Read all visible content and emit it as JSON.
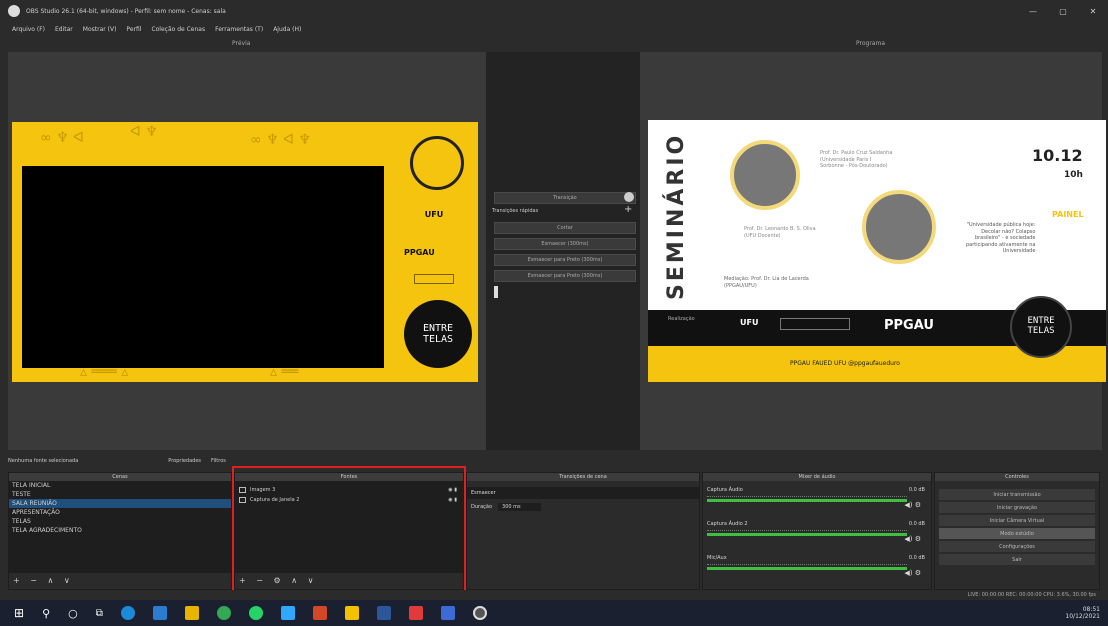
{
  "titlebar": {
    "title": "OBS Studio 26.1 (64-bit, windows) - Perfil: sem nome - Cenas: sala",
    "min": "—",
    "max": "▢",
    "close": "✕"
  },
  "menu": [
    "Arquivo (F)",
    "Editar",
    "Mostrar (V)",
    "Perfil",
    "Coleção de Cenas",
    "Ferramentas (T)",
    "Ajuda (H)"
  ],
  "labels": {
    "preview": "Prévia",
    "program": "Programa"
  },
  "transition_panel": {
    "transicao": "Transição",
    "transicoes_rapidas": "Transições rápidas",
    "cortar": "Cortar",
    "esmaecer": "Esmaecer (300ms)",
    "esmaecer_preto1": "Esmaecer para Preto (300ms)",
    "esmaecer_preto2": "Esmaecer para Preto (300ms)"
  },
  "source_status": {
    "text": "Nenhuma fonte selecionada",
    "props": "Propriedades",
    "filters": "Filtros"
  },
  "scenes": {
    "header": "Cenas",
    "items": [
      "TELA INICIAL",
      "TESTE",
      "SALA REUNIÃO",
      "APRESENTAÇÃO",
      "TELAS",
      "TELA AGRADECIMENTO"
    ],
    "selected_index": 2,
    "tools": "+ − ∧ ∨"
  },
  "sources": {
    "header": "Fontes",
    "items": [
      "Imagem 3",
      "Captura de Janela 2"
    ],
    "tools": "+ − ⚙ ∧ ∨"
  },
  "transitions_dock": {
    "header": "Transições de cena",
    "row1": "Esmaecer",
    "row2_label": "Duração",
    "row2_value": "300 ms"
  },
  "mixer": {
    "header": "Mixer de áudio",
    "channels": [
      {
        "name": "Captura Áudio",
        "db": "0.0 dB"
      },
      {
        "name": "Captura Áudio 2",
        "db": "0.0 dB"
      },
      {
        "name": "Mic/Aux",
        "db": "0.0 dB"
      }
    ]
  },
  "controls": {
    "header": "Controles",
    "buttons": [
      "Iniciar transmissão",
      "Iniciar gravação",
      "Iniciar Câmera Virtual",
      "Modo estúdio",
      "Configurações",
      "Sair"
    ],
    "selected_index": 3
  },
  "statusbar": {
    "text": "LIVE: 00:00:00   REC: 00:00:00   CPU: 3.6%, 30.00 fps"
  },
  "preview_graphic": {
    "ufu": "UFU",
    "ppgau": "PPGAU",
    "entre": "ENTRE",
    "telas": "TELAS"
  },
  "program_graphic": {
    "seminario": "SEMINÁRIO",
    "speaker1": "Prof. Dr. Paulo Cruz Saldanha\n(Universidade Paris I\nSorbonne - Pós-Doutorado)",
    "speaker2": "Prof. Dr. Leonardo B. S. Oliva\n(UFU Docente)",
    "mediacao": "Mediação: Prof. Dr. Lia de Lacerda\n(PPGAU/UFU)",
    "date": "10.12",
    "time": "10h",
    "painel": "PAINEL",
    "painel_text": "\"Universidade pública hoje:\nDecolar não? Colapso\nbrasileiro\" - e sociedade\nparticipando ativamente na\nUniversidade",
    "realizacao": "Realização",
    "ufu": "UFU",
    "ppgau": "PPGAU",
    "entre": "ENTRE",
    "telas": "TELAS",
    "social": "PPGAU FAUED UFU    @ppgaufaueduro"
  },
  "taskbar": {
    "time": "08:51",
    "date": "10/12/2021"
  }
}
